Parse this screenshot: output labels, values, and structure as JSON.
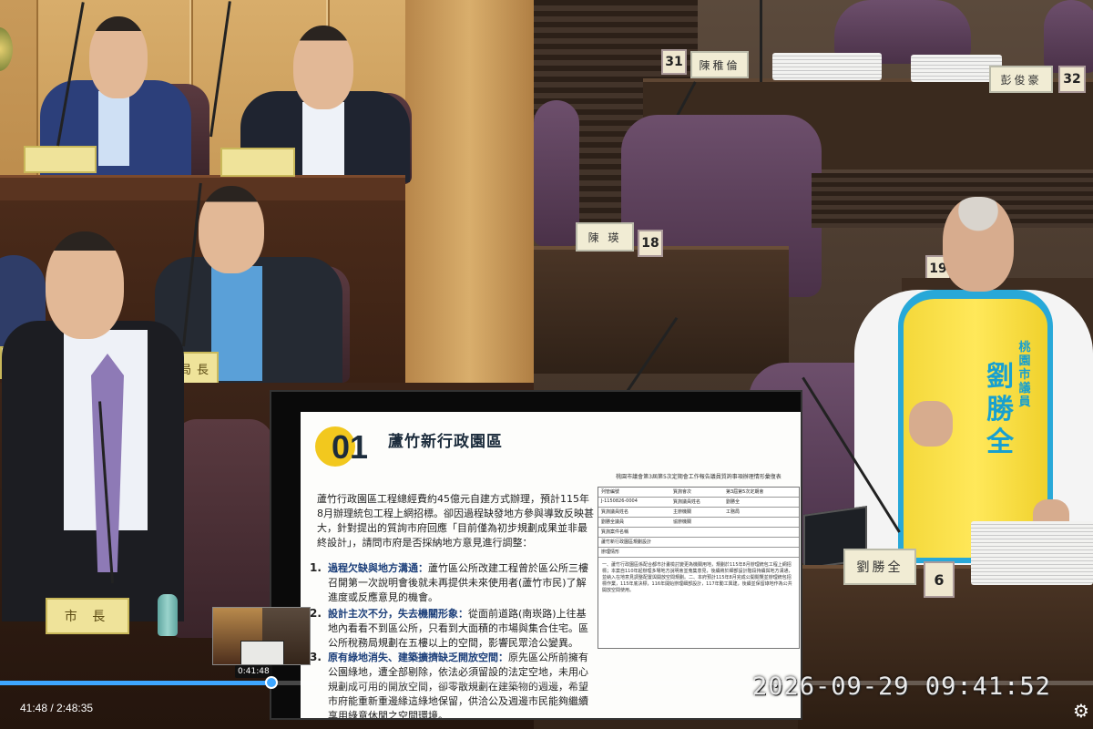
{
  "video": {
    "current_time": "41:48",
    "separator": " / ",
    "duration": "2:48:35",
    "hover_time": "0:41:48",
    "progress": 0.248,
    "buffered": 0.38,
    "accent_color": "#3ea6ff",
    "settings_icon": "gear-icon"
  },
  "overlay": {
    "timestamp": "2026-09-29  09:41:52"
  },
  "left_cam": {
    "nameplates": {
      "top_left": "",
      "top_mid": "",
      "mid_right": "局長",
      "mayor": "市 長"
    }
  },
  "right_cam": {
    "seat_31_num": "31",
    "seat_31_name": "陳稚倫",
    "seat_32_num": "32",
    "seat_32_name": "彭俊豪",
    "seat_18_num": "18",
    "seat_18_name": "陳 瑛",
    "seat_19_num": "19",
    "speaker_num": "6",
    "speaker_name": "劉勝全",
    "vest_small": "桃園市議員",
    "vest_name": "劉勝全"
  },
  "slide": {
    "badge": "01",
    "title": "蘆竹新行政園區",
    "intro": "蘆竹行政園區工程總經費約45億元自建方式辦理，預計115年8月辦理統包工程上網招標。卻因過程缺發地方參與導致反映甚大，針對提出的質詢市府回應「目前僅為初步規劃成果並非最終設計」，請問市府是否採納地方意見進行調整：",
    "items": [
      {
        "num": "1.",
        "head": "過程欠缺與地方溝通：",
        "body": "蘆竹區公所改建工程曾於區公所三樓召開第一次說明會後就未再提供未來使用者(蘆竹市民)了解進度或反應意見的機會。"
      },
      {
        "num": "2.",
        "head": "設計主次不分，失去機關形象：",
        "body": "從面前道路(南崁路)上往基地內看看不到區公所，只看到大面積的市場與集合住宅。區公所稅務局規劃在五樓以上的空間，影響民眾洽公變異。"
      },
      {
        "num": "3.",
        "head": "原有綠地消失、建築擴擠缺乏開放空間：",
        "body": "原先區公所前擁有公園綠地，遭全部剔除，依法必須留設的法定空地，未用心規劃成可用的開放空間，卻零散規劃在建築物的週邊，希望市府能重新重邊緣這綠地保留，供洽公及週邊市民能夠繼續享用綠意休閒之空間環境。"
      }
    ],
    "form": {
      "title": "桃園市議會第3屆第5次定期會工作報告議員質詢事項辦理情形彙復表",
      "rows": [
        [
          "列管編號",
          "質詢會次",
          "第3屆第5次定期會"
        ],
        [
          "J-1150826-0004",
          "質詢議員姓名",
          "劉勝全"
        ],
        [
          "質詢議員姓名",
          "主辦機關",
          "工務局"
        ],
        [
          "劉勝全議員",
          "協辦機關",
          ""
        ],
        [
          "質詢案件名稱",
          "",
          ""
        ],
        [
          "蘆竹新行政園區規劃設計",
          "",
          ""
        ],
        [
          "辦理情形",
          "",
          ""
        ]
      ],
      "body": "一、蘆竹行政園區係配合都市計畫檢討變更為機關用地，規劃於115年8月辦理統包工程上網招標；本案自110年起辦理多場地方說明會並蒐集意見，後續將於細部設計階段持續與地方溝通，並納入在地意見調整配置與開放空間規劃。二、本府預計115年8月完成公開閱覽並辦理統包招標作業，115年底決標，116年開始辦理細部設計，117年動工興建，後續並保留綠地作為公共開放空間使用。"
    }
  }
}
